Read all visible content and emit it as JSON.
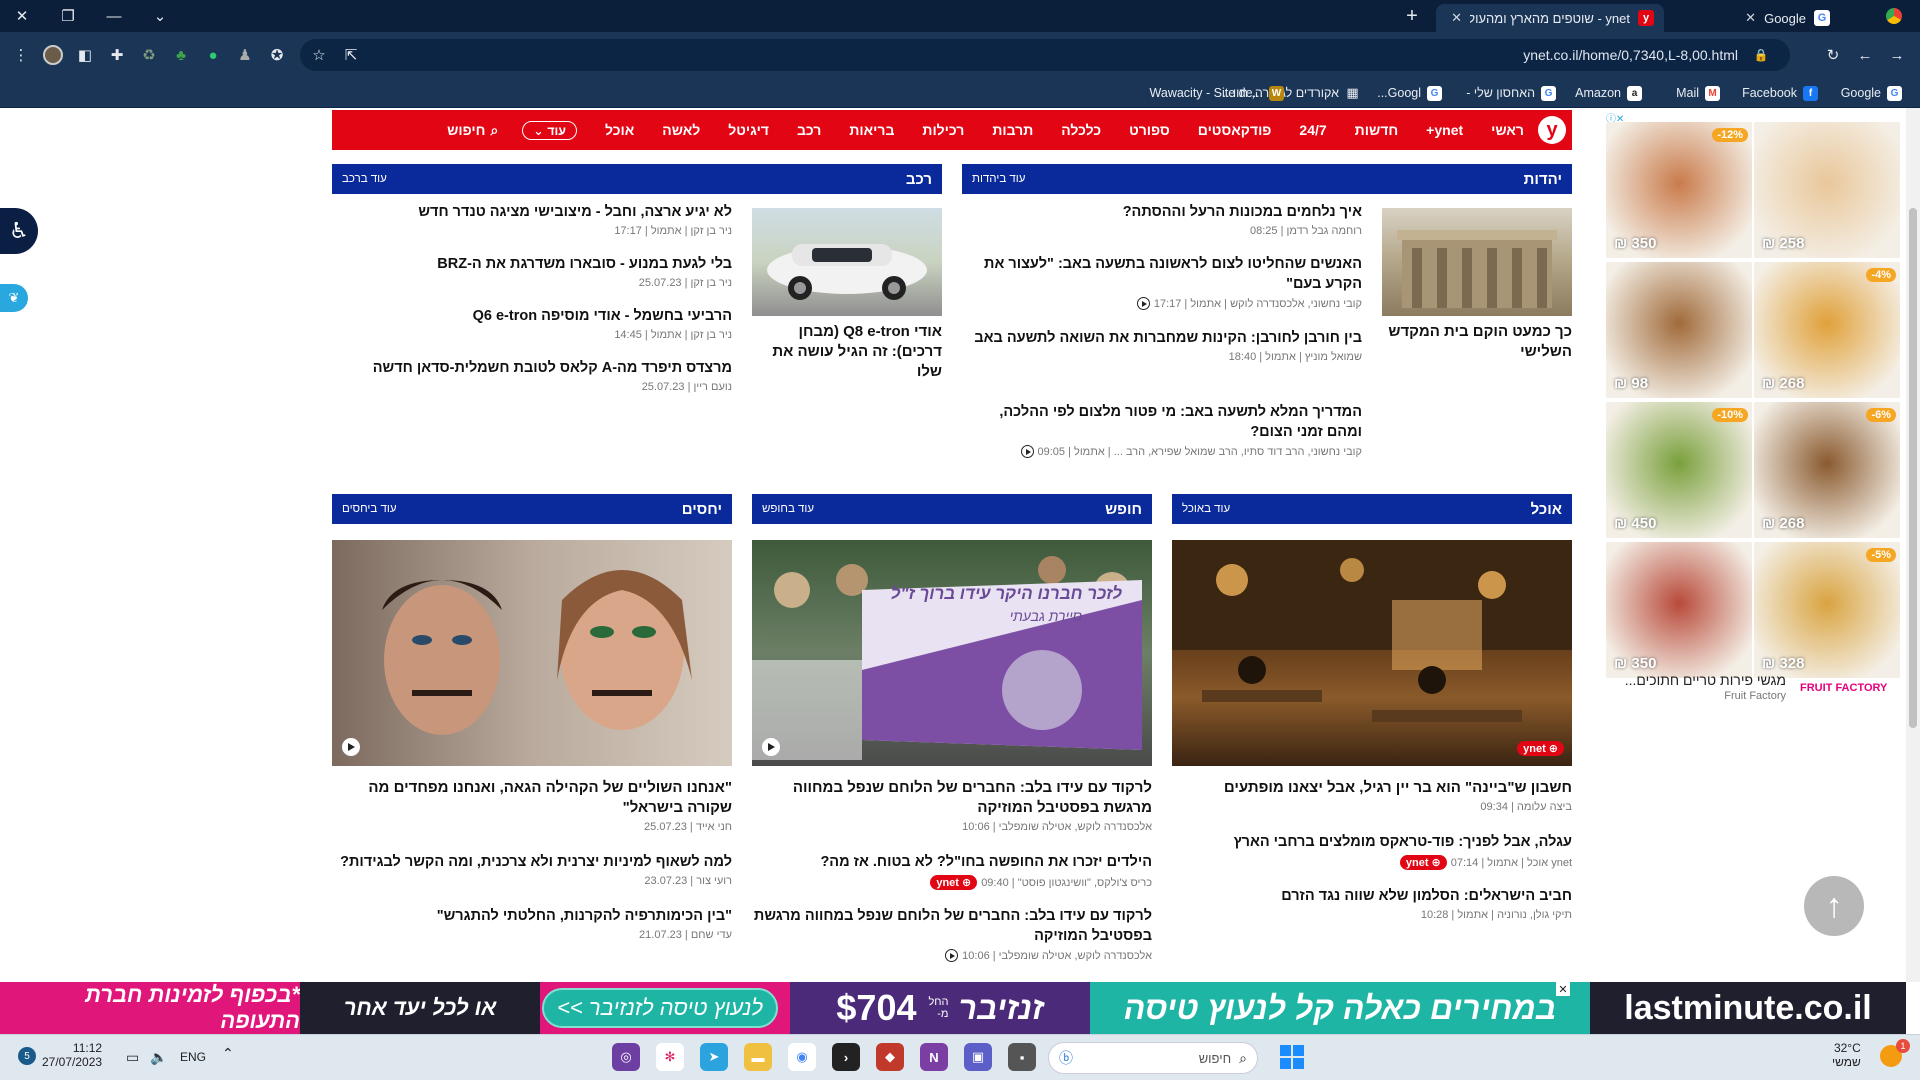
{
  "browser": {
    "tabs": [
      {
        "title": "ynet - שוטפים מהארץ ומהעולם",
        "active": true
      },
      {
        "title": "Google",
        "active": false
      }
    ],
    "new_tab": "+",
    "url": "ynet.co.il/home/0,7340,L-8,00.html",
    "bookmarks": [
      {
        "label": "Google",
        "icon": "google-icon",
        "color": "#4285f4"
      },
      {
        "label": "Facebook",
        "icon": "facebook-icon",
        "color": "#1877f2"
      },
      {
        "label": "Mail",
        "icon": "gmail-icon",
        "color": "#ea4335"
      },
      {
        "label": "Amazon",
        "icon": "amazon-icon",
        "color": "#222222"
      },
      {
        "label": "האחסון שלי -",
        "icon": "google-drive-icon",
        "color": "#4285f4"
      },
      {
        "label": "Googl...",
        "icon": "google-icon",
        "color": "#4285f4"
      },
      {
        "label": "אקורדים לגיטרה, תוו...",
        "icon": "grid-icon",
        "color": "#555555"
      },
      {
        "label": "Wawacity - Site de...",
        "icon": "wawacity-icon",
        "color": "#b8860b"
      }
    ]
  },
  "nav": {
    "logo": "y",
    "items": [
      "ראשי",
      "ynet+",
      "חדשות",
      "24/7",
      "פודקאסטים",
      "ספורט",
      "כלכלה",
      "תרבות",
      "רכילות",
      "בריאות",
      "רכב",
      "דיגיטל",
      "לאשה",
      "אוכל"
    ],
    "more": "עוד",
    "search": "חיפוש"
  },
  "sections": {
    "yahadut": {
      "title": "יהדות",
      "more": "עוד ביהדות",
      "main": {
        "headline": "כך כמעט הוקם בית המקדש השלישי"
      },
      "articles": [
        {
          "headline": "איך נלחמים במכונות הרעל וההסתה?",
          "meta": "רוחמה גבל רדמן | 08:25"
        },
        {
          "headline": "האנשים שהחליטו לצום לראשונה בתשעה באב: \"לעצור את הקרע בעם\"",
          "meta": "קובי נחשוני, אלכסנדרה לוקש | אתמול | 17:17"
        },
        {
          "headline": "בין חורבן לחורבן: הקינות שמחברות את השואה לתשעה באב",
          "meta": "שמואל מוניץ | אתמול | 18:40"
        },
        {
          "headline": "המדריך המלא לתשעה באב: מי פטור מלצום לפי ההלכה, ומהם זמני הצום?",
          "meta": "קובי נחשוני, הרב דוד סתיו, הרב שמואל שפירא, הרב ... | אתמול | 09:05"
        }
      ]
    },
    "rechev": {
      "title": "רכב",
      "more": "עוד ברכב",
      "main": {
        "headline": "אודי Q8 e-tron (מבחן דרכים): זה הגיל עושה את שלו"
      },
      "articles": [
        {
          "headline": "לא יגיע ארצה, וחבל - מיצובישי מציגה טנדר חדש",
          "meta": "ניר בן זקן | אתמול | 17:17"
        },
        {
          "headline": "בלי לגעת במנוע - סובארו משדרגת את ה-BRZ",
          "meta": "ניר בן זקן | 25.07.23"
        },
        {
          "headline": "הרביעי בחשמל - אודי מוסיפה Q6 e-tron",
          "meta": "ניר בן זקן | אתמול | 14:45"
        },
        {
          "headline": "מרצדס תיפרד מה-A קלאס לטובת חשמלית-סדאן חדשה",
          "meta": "נועם ריין | 25.07.23"
        }
      ]
    },
    "ochel": {
      "title": "אוכל",
      "more": "עוד באוכל",
      "articles": [
        {
          "headline": "חשבון ש\"ביינה\" הוא בר יין רגיל, אבל יצאנו מופתעים",
          "meta": "ביצה עלומה | 09:34"
        },
        {
          "headline": "עגלה, אבל לפניך: פוד-טראקס מומלצים ברחבי הארץ",
          "meta": "ynet אוכל | אתמול | 07:14"
        },
        {
          "headline": "חביב הישראלים: הסלמון שלא שווה נגד הזרם",
          "meta": "תיקי גולן, נורוניה | אתמול | 10:28"
        }
      ]
    },
    "chofesh": {
      "title": "חופש",
      "more": "עוד בחופש",
      "flag_text": "לזכר חברנו היקר עידו ברוך ז\"ל",
      "flag_sub": "סיירת גבעתי",
      "articles": [
        {
          "headline": "לרקוד עם עידו בלב: החברים של הלוחם שנפל במחווה מרגשת בפסטיבל המוזיקה",
          "meta": "אלכסנדרה לוקש, אטילה שומפלבי | 10:06"
        },
        {
          "headline": "הילדים יזכרו את החופשה בחו\"ל? לא בטוח. אז מה?",
          "meta": "כריס צ'ולקס, \"וושינגטון פוסט\" | 09:40"
        },
        {
          "headline": "לרקוד עם עידו בלב: החברים של הלוחם שנפל במחווה מרגשת בפסטיבל המוזיקה",
          "meta": "אלכסנדרה לוקש, אטילה שומפלבי | 10:06"
        }
      ]
    },
    "yachasim": {
      "title": "יחסים",
      "more": "עוד ביחסים",
      "articles": [
        {
          "headline": "\"אנחנו השוליים של הקהילה הגאה, ואנחנו מפחדים מה שקורה בישראל\"",
          "meta": "חני אייד | 25.07.23"
        },
        {
          "headline": "למה לשאוף למיניות יצרנית ולא צרכנית, ומה הקשר לבגידות?",
          "meta": "רועי צור | 23.07.23"
        },
        {
          "headline": "\"בין הכימותרפיה להקרנות, החלטתי להתגרש\"",
          "meta": "עדי שחם | 21.07.23"
        }
      ]
    }
  },
  "ynet_plus_badge": "ynet",
  "ad": {
    "tiles": [
      {
        "price": "₪ 258",
        "discount": "",
        "color": "#e9c79a"
      },
      {
        "price": "₪ 350",
        "discount": "-12%",
        "color": "#c97b4b"
      },
      {
        "price": "₪ 268",
        "discount": "-4%",
        "color": "#e0a13a"
      },
      {
        "price": "₪ 98",
        "discount": "",
        "color": "#a06a3a"
      },
      {
        "price": "₪ 268",
        "discount": "-6%",
        "color": "#8a5a2f"
      },
      {
        "price": "₪ 450",
        "discount": "-10%",
        "color": "#7aa03c"
      },
      {
        "price": "₪ 328",
        "discount": "-5%",
        "color": "#d9a441"
      },
      {
        "price": "₪ 350",
        "discount": "",
        "color": "#b84a3a"
      }
    ],
    "caption": "מגשי פירות טריים חתוכים...",
    "brand": "Fruit Factory",
    "logo": "FRUIT FACTORY"
  },
  "banner": {
    "logo": "lastminute.co.il",
    "headline": "במחירים כאלה קל לנעוץ טיסה",
    "dest": "זנזיבר",
    "price_prefix": "החל מ-",
    "price": "$704",
    "cta": "לנעוץ טיסה לזנזיבר >>",
    "sub": "או לכל יעד אחר",
    "tagline": "*בכפוף לזמינות חברת התעופה"
  },
  "taskbar": {
    "time": "11:12",
    "date": "27/07/2023",
    "lang": "ENG",
    "weather": "32°C",
    "weather_sub": "שמשי",
    "search": "חיפוש",
    "badge": "5",
    "notif": "1"
  }
}
